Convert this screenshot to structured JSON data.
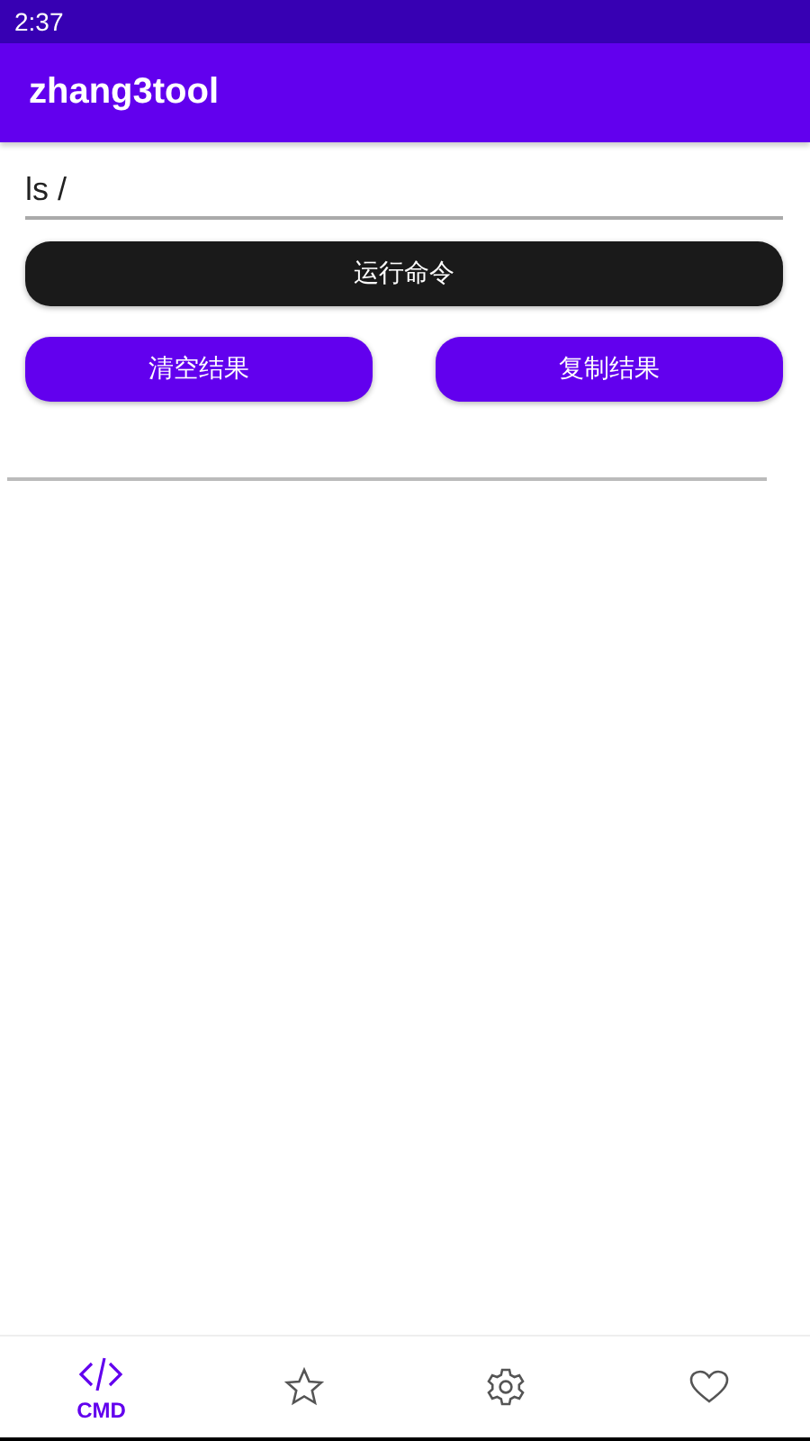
{
  "status_bar": {
    "time": "2:37"
  },
  "app_bar": {
    "title": "zhang3tool"
  },
  "command_field": {
    "value": "ls /"
  },
  "run_button": {
    "label": "运行命令"
  },
  "action_buttons": [
    {
      "label": "清空结果"
    },
    {
      "label": "复制结果"
    }
  ],
  "bottom_nav": [
    {
      "kind": "code",
      "label": "CMD",
      "selected": true
    },
    {
      "kind": "star",
      "selected": false
    },
    {
      "kind": "gear",
      "selected": false
    },
    {
      "kind": "heart",
      "selected": false
    }
  ]
}
